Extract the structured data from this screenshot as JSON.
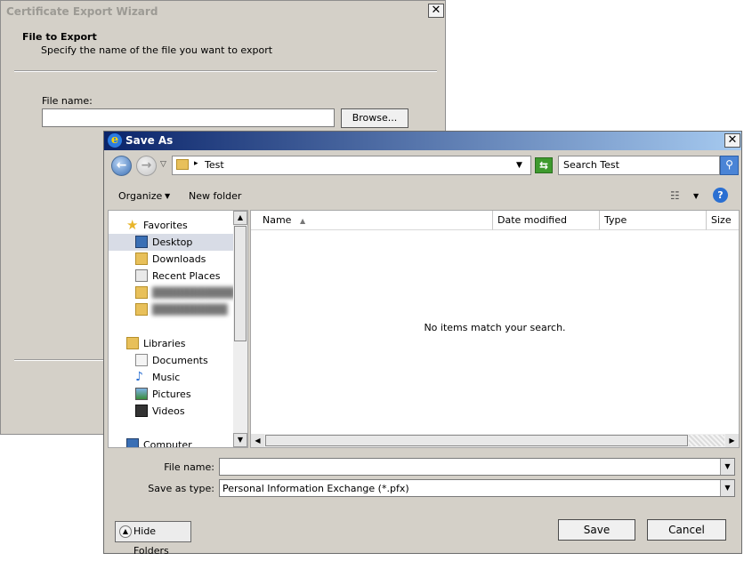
{
  "wizard": {
    "title": "Certificate Export Wizard",
    "header_title": "File to Export",
    "header_subtitle": "Specify the name of the file you want to export",
    "file_name_label": "File name:",
    "file_name_value": "",
    "browse_label": "Browse..."
  },
  "save_as": {
    "title": "Save As",
    "address": {
      "separator": "▸",
      "path": "Test"
    },
    "search_placeholder": "Search Test",
    "toolbar": {
      "organize": "Organize",
      "new_folder": "New folder"
    },
    "nav": {
      "favorites": "Favorites",
      "desktop": "Desktop",
      "downloads": "Downloads",
      "recent_places": "Recent Places",
      "blurred_1": "███████████",
      "blurred_2": "██████████",
      "libraries": "Libraries",
      "documents": "Documents",
      "music": "Music",
      "pictures": "Pictures",
      "videos": "Videos",
      "computer": "Computer"
    },
    "columns": [
      "Name",
      "Date modified",
      "Type",
      "Size"
    ],
    "empty_message": "No items match your search.",
    "file_name_label": "File name:",
    "file_name_value": "",
    "save_as_type_label": "Save as type:",
    "save_as_type_value": "Personal Information Exchange (*.pfx)",
    "hide_folders": "Hide Folders",
    "save_button": "Save",
    "cancel_button": "Cancel"
  }
}
